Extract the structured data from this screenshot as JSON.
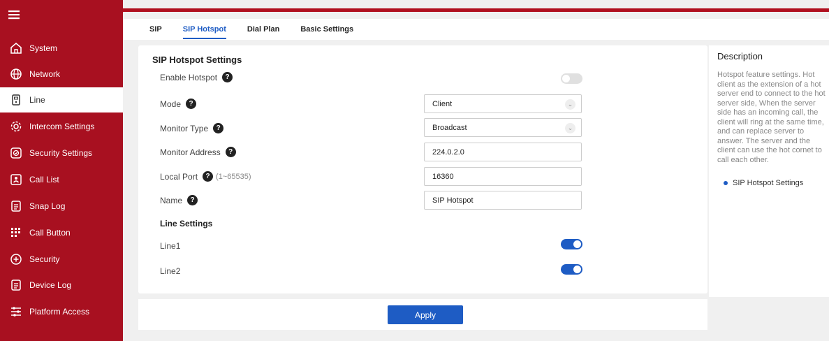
{
  "sidebar": {
    "items": [
      {
        "label": "System",
        "icon": "home-icon"
      },
      {
        "label": "Network",
        "icon": "globe-icon"
      },
      {
        "label": "Line",
        "icon": "phone-icon"
      },
      {
        "label": "Intercom Settings",
        "icon": "gear-icon"
      },
      {
        "label": "Security Settings",
        "icon": "shield-icon"
      },
      {
        "label": "Call List",
        "icon": "contact-list-icon"
      },
      {
        "label": "Snap Log",
        "icon": "document-icon"
      },
      {
        "label": "Call Button",
        "icon": "keypad-icon"
      },
      {
        "label": "Security",
        "icon": "security-plus-icon"
      },
      {
        "label": "Device Log",
        "icon": "log-icon"
      },
      {
        "label": "Platform Access",
        "icon": "sliders-icon"
      }
    ],
    "active_index": 2,
    "color": "#a81020"
  },
  "tabs": [
    {
      "label": "SIP"
    },
    {
      "label": "SIP Hotspot"
    },
    {
      "label": "Dial Plan"
    },
    {
      "label": "Basic Settings"
    }
  ],
  "active_tab": 1,
  "settings": {
    "title": "SIP Hotspot Settings",
    "enable_hotspot_label": "Enable Hotspot",
    "enable_hotspot_on": false,
    "mode_label": "Mode",
    "mode_value": "Client",
    "monitor_type_label": "Monitor Type",
    "monitor_type_value": "Broadcast",
    "monitor_address_label": "Monitor Address",
    "monitor_address_value": "224.0.2.0",
    "local_port_label": "Local Port",
    "local_port_range": "(1~65535)",
    "local_port_value": "16360",
    "name_label": "Name",
    "name_value": "SIP Hotspot",
    "help_glyph": "?"
  },
  "line_settings": {
    "title": "Line Settings",
    "line1_label": "Line1",
    "line1_on": true,
    "line2_label": "Line2",
    "line2_on": true
  },
  "apply_label": "Apply",
  "description": {
    "title": "Description",
    "body": "Hotspot feature settings. Hot client as the extension of a hot server end to connect to the hot server side, When the server side has an incoming call, the client will ring at the same time, and can replace server to answer. The server and the client can use the hot cornet to call each other.",
    "link": "SIP Hotspot Settings"
  },
  "colors": {
    "accent": "#1e5cc4",
    "brand": "#a81020"
  }
}
